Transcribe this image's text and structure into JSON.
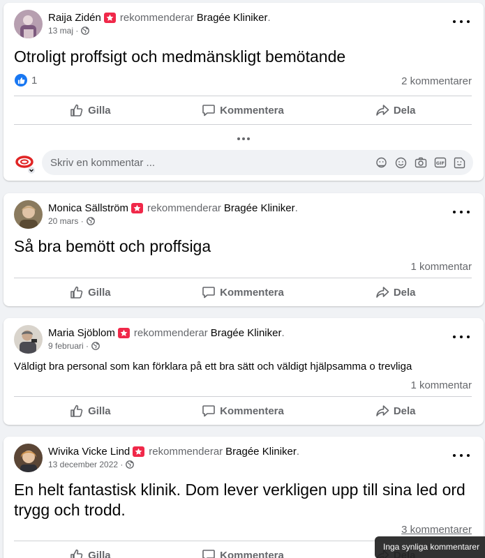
{
  "common": {
    "verb": "rekommenderar",
    "page_name": "Bragée Kliniker",
    "period": ".",
    "dot": "·",
    "like_label": "Gilla",
    "comment_label": "Kommentera",
    "share_label": "Dela",
    "recommend_icon": "recommend-star-icon",
    "privacy_icon": "globe-icon",
    "accent_color": "#1877f2",
    "badge_color": "#f02849"
  },
  "posts": [
    {
      "author": "Raija Zidén",
      "date": "13 maj",
      "text": "Otroligt proffsigt och medmänskligt bemötande",
      "reactions": "1",
      "comments": "2 kommentarer"
    },
    {
      "author": "Monica Sällström",
      "date": "20 mars",
      "text": "Så bra bemött och proffsiga",
      "comments": "1 kommentar"
    },
    {
      "author": "Maria Sjöblom",
      "date": "9 februari",
      "text": "Väldigt bra personal som kan förklara på ett bra sätt och väldigt hjälpsamma o trevliga",
      "comments": "1 kommentar"
    },
    {
      "author": "Wivika Vicke Lind",
      "date": "13 december 2022",
      "text": "En helt fantastisk klinik. Dom lever verkligen upp till sina led ord trygg och trodd.",
      "comments": "3 kommentarer"
    }
  ],
  "comment_box": {
    "placeholder": "Skriv en kommentar ...",
    "tools": [
      "avatar-sticker-icon",
      "emoji-icon",
      "camera-icon",
      "gif-icon",
      "sticker-icon"
    ]
  },
  "tooltip": "Inga synliga kommentarer"
}
